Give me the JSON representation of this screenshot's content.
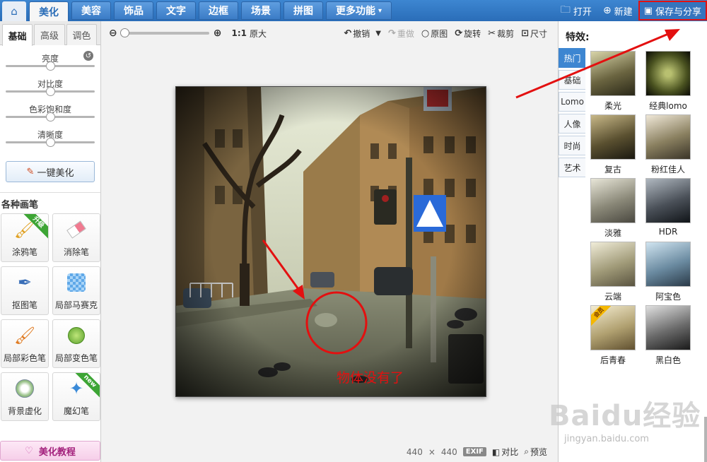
{
  "topnav": {
    "tabs": [
      {
        "label": "美化",
        "active": true
      },
      {
        "label": "美容"
      },
      {
        "label": "饰品"
      },
      {
        "label": "文字"
      },
      {
        "label": "边框"
      },
      {
        "label": "场景"
      },
      {
        "label": "拼图"
      },
      {
        "label": "更多功能",
        "has_caret": true
      }
    ],
    "open_label": "打开",
    "new_label": "新建",
    "save_share_label": "保存与分享"
  },
  "left": {
    "subtabs": [
      "基础",
      "高级",
      "调色"
    ],
    "sliders": [
      {
        "label": "亮度",
        "value": 0.5
      },
      {
        "label": "对比度",
        "value": 0.5
      },
      {
        "label": "色彩饱和度",
        "value": 0.5
      },
      {
        "label": "清晰度",
        "value": 0.5
      }
    ],
    "one_key_label": "一键美化",
    "brush_title": "各种画笔",
    "brushes": [
      {
        "label": "涂鸦笔",
        "ribbon": "升级"
      },
      {
        "label": "消除笔"
      },
      {
        "label": "抠图笔"
      },
      {
        "label": "局部马赛克"
      },
      {
        "label": "局部彩色笔"
      },
      {
        "label": "局部变色笔"
      },
      {
        "label": "背景虚化"
      },
      {
        "label": "魔幻笔",
        "ribbon": "new"
      }
    ],
    "tutorial_label": "美化教程"
  },
  "toolbar": {
    "ratio_label": "1:1",
    "orig_size_label": "原大",
    "undo_label": "撤销",
    "redo_label": "重做",
    "original_label": "原图",
    "rotate_label": "旋转",
    "crop_label": "裁剪",
    "size_label": "尺寸"
  },
  "status": {
    "width": "440",
    "times": "×",
    "height": "440",
    "exif_label": "EXIF",
    "compare_label": "对比",
    "preview_label": "预览"
  },
  "right": {
    "title": "特效:",
    "categories": [
      "热门",
      "基础",
      "Lomo",
      "人像",
      "时尚",
      "艺术"
    ],
    "active_category": "热门",
    "effects": [
      {
        "label": "柔光"
      },
      {
        "label": "经典lomo"
      },
      {
        "label": "复古"
      },
      {
        "label": "粉红佳人"
      },
      {
        "label": "淡雅"
      },
      {
        "label": "HDR"
      },
      {
        "label": "云端"
      },
      {
        "label": "阿宝色"
      },
      {
        "label": "后青春",
        "tag": "会员"
      },
      {
        "label": "黑白色"
      }
    ]
  },
  "annotation": {
    "text": "物体没有了",
    "color": "#e31010"
  },
  "watermark": {
    "main": "Baidu经验",
    "sub": "jingyan.baidu.com"
  },
  "colors": {
    "nav_blue": "#2a6db8",
    "accent_red": "#e31010"
  }
}
